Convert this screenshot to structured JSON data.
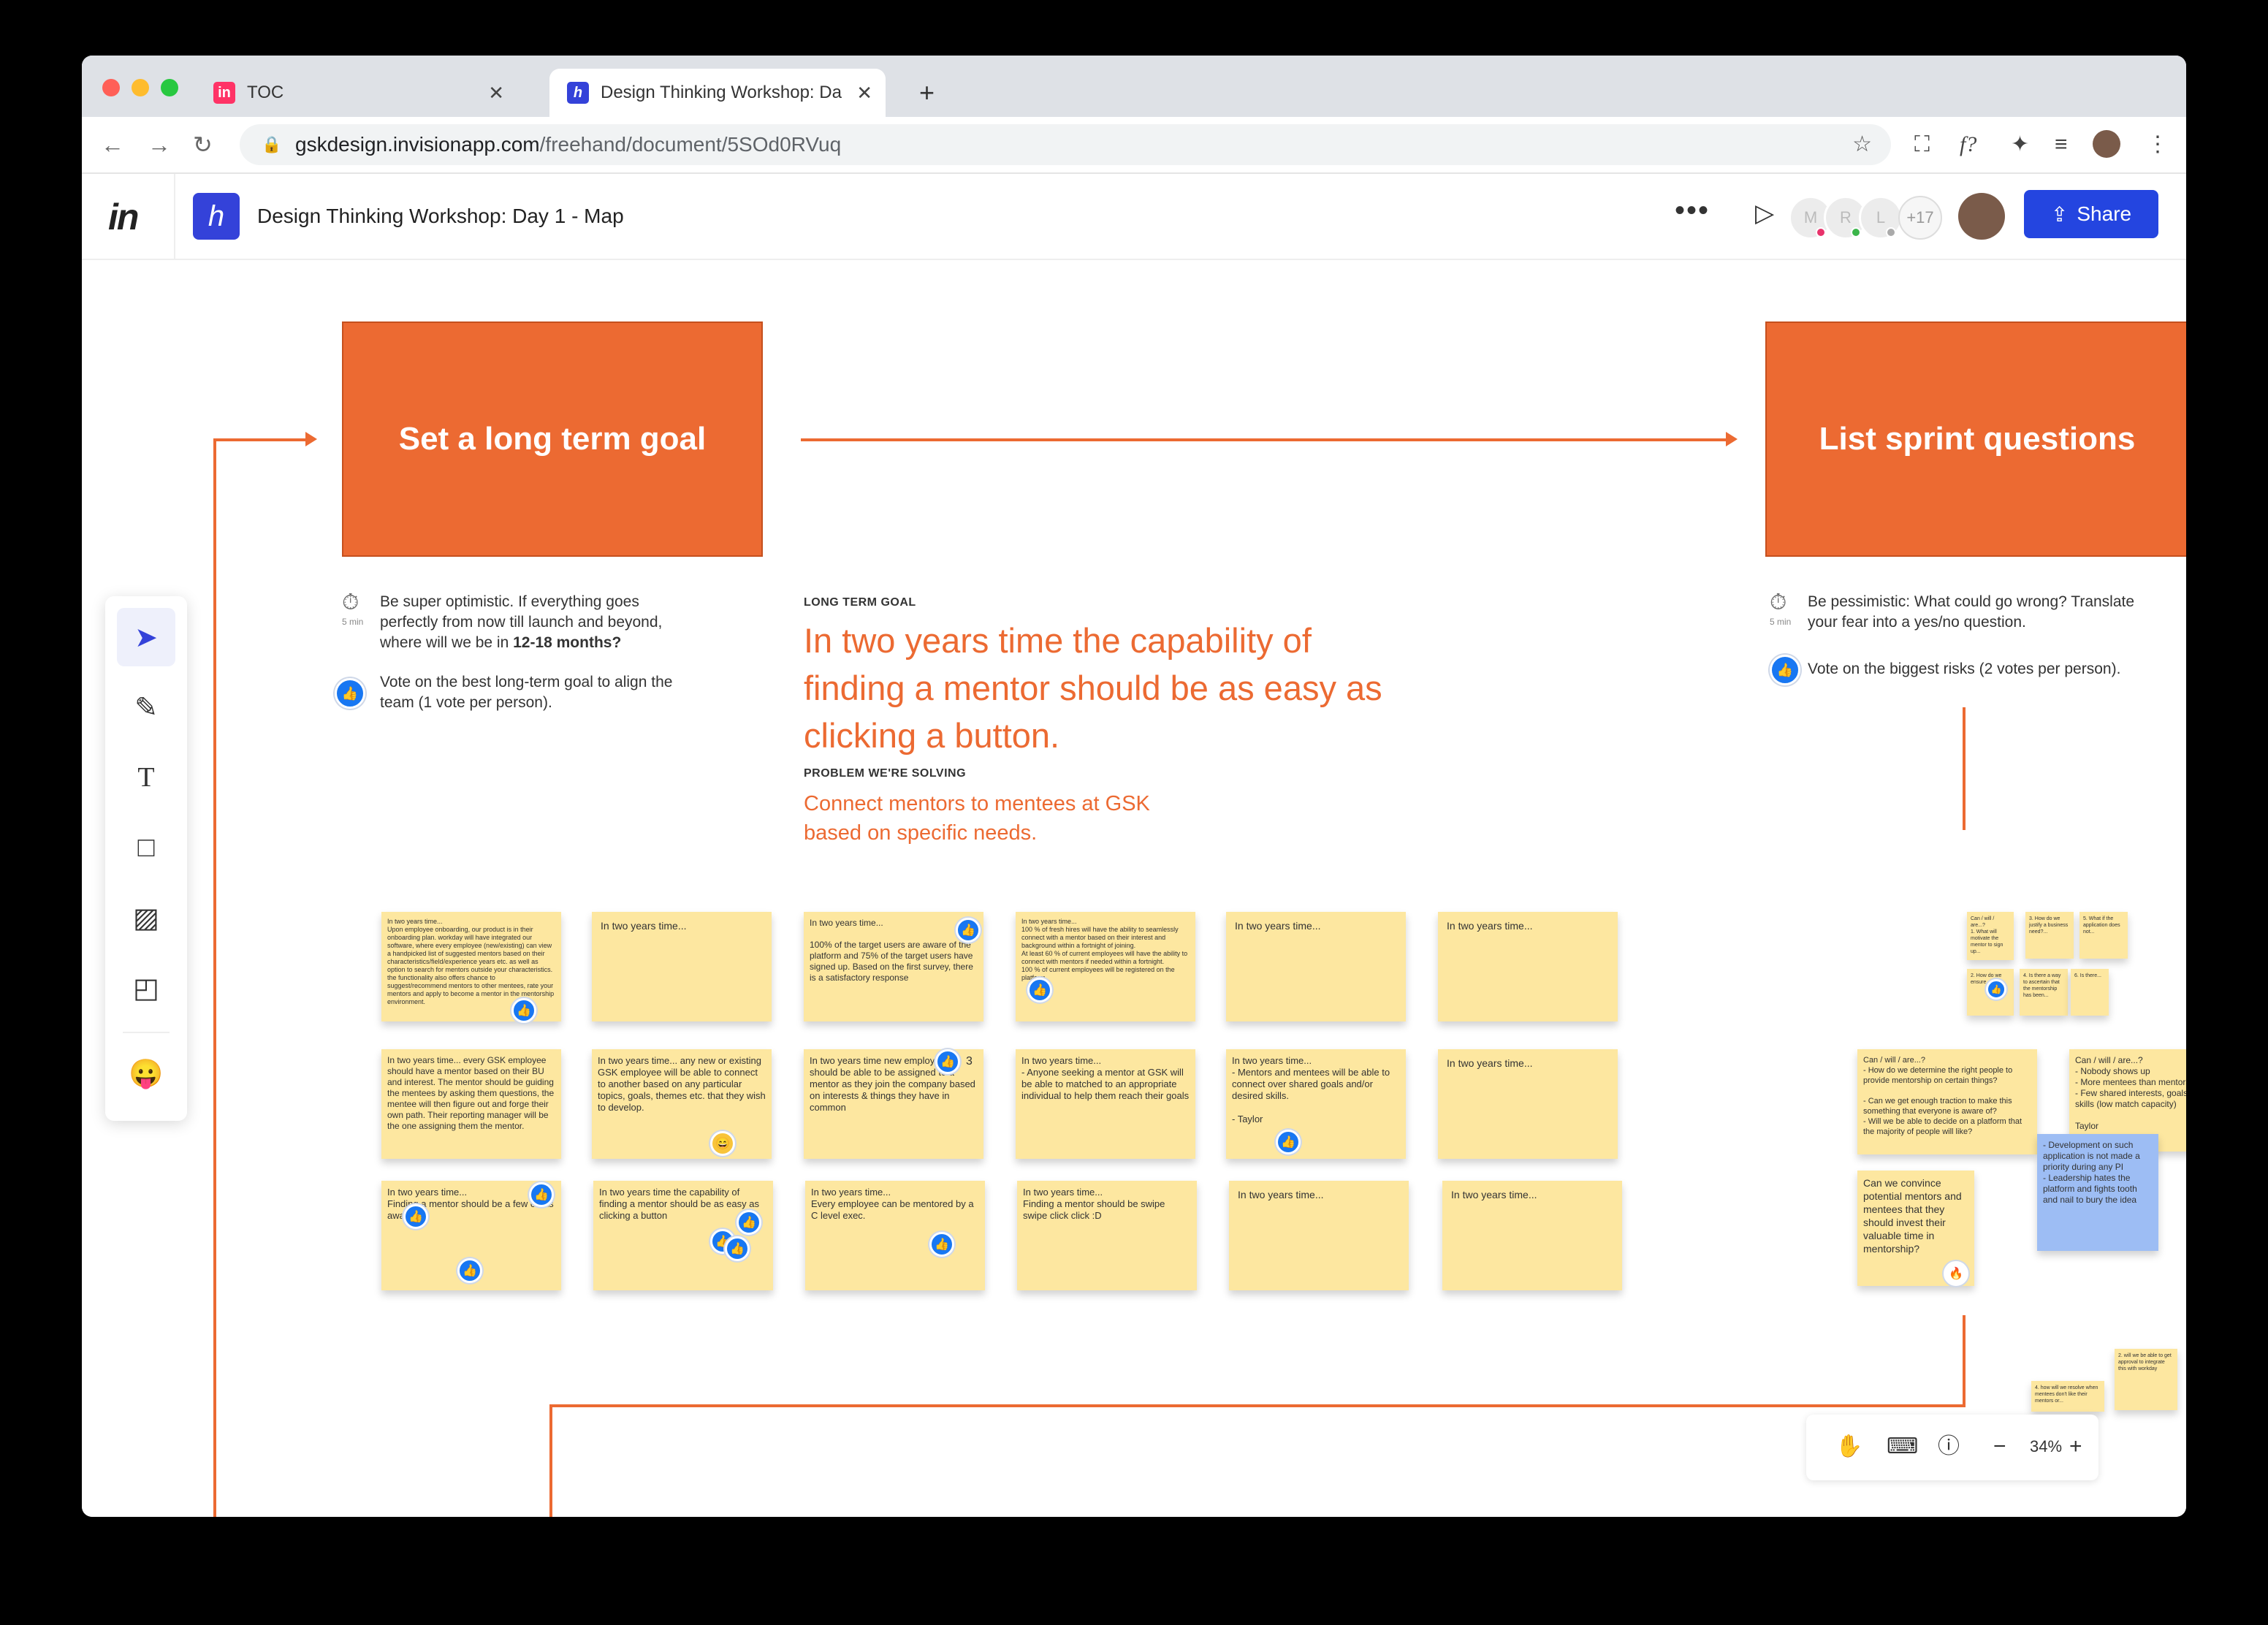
{
  "browser": {
    "tabs": [
      {
        "title": "TOC",
        "favicon": "in"
      },
      {
        "title": "Design Thinking Workshop: Da",
        "favicon": "h"
      }
    ],
    "url_host": "gskdesign.invisionapp.com",
    "url_path": "/freehand/document/5SOd0RVuq"
  },
  "app": {
    "logo": "in",
    "doc_title": "Design Thinking Workshop: Day 1 - Map",
    "more_label": "•••",
    "collaborators": [
      "M",
      "R",
      "L"
    ],
    "collaborator_overflow": "+17",
    "share_label": "Share"
  },
  "board": {
    "goal_box": "Set a long term goal",
    "sprint_box": "List sprint questions",
    "left_timer": "5 min",
    "left_instruction_1": "Be super optimistic. If everything goes perfectly from now till launch and beyond, where will we be in ",
    "left_instruction_bold": "12-18 months?",
    "left_instruction_2": "Vote on the best long-term goal to align the team (1 vote per person).",
    "right_timer": "5 min",
    "right_instruction_1": "Be pessimistic: What could go wrong? Translate your fear into a yes/no question.",
    "right_instruction_2": "Vote on the biggest risks (2 votes per person).",
    "goal_label": "LONG TERM GOAL",
    "goal_text": "In two years time the capability of finding a mentor should be as easy as clicking a button.",
    "problem_label": "PROBLEM WE'RE SOLVING",
    "problem_text": "Connect mentors to mentees at GSK based on specific needs."
  },
  "notes": [
    {
      "text": "In two years time...\nUpon employee onboarding, our product is in their onboarding plan. workday will have integrated our software, where every employee (new/existing) can view a handpicked list of suggested mentors based on their characteristics/field/experience years etc. as well as option to search for mentors outside your characteristics. the functionality also offers chance to suggest/recommend mentors to other mentees, rate your mentors and apply to become a mentor in the mentorship environment."
    },
    {
      "text": "In two years time..."
    },
    {
      "text": "In two years time...\n\n100% of the target users are aware of the platform and 75% of the target users have signed up. Based on the first survey, there is a satisfactory response"
    },
    {
      "text": "In two years time...\n100 % of fresh hires will have the ability to seamlessly connect with a mentor based on their interest and background within a fortnight of joining.\nAt least 60 % of current employees will have the ability to connect with mentors if needed within a fortnight.\n100 % of current employees will be registered on the platform"
    },
    {
      "text": "In two years time..."
    },
    {
      "text": "In two years time..."
    },
    {
      "text": "In two years time... every GSK employee should have a mentor based on their BU and interest. The mentor should be guiding the mentees by asking them questions, the mentee will then figure out and forge their own path. Their reporting manager will be the one assigning them the mentor."
    },
    {
      "text": "In two years time... any new or existing GSK employee will be able to connect to another based on any particular topics, goals, themes etc. that they wish to develop."
    },
    {
      "text": "In two years time new employees should be able to be assigned to a mentor as they join the company based on interests & things they have in common"
    },
    {
      "text": "In two years time...\n- Anyone seeking a mentor at GSK will be able to matched to an appropriate individual to help them reach their goals"
    },
    {
      "text": "In two years time...\n- Mentors and mentees will be able to connect over shared goals and/or desired skills.\n\n- Taylor"
    },
    {
      "text": "In two years time..."
    },
    {
      "text": "In two years time...\nFinding a mentor should be a few clicks away"
    },
    {
      "text": "In two years time the capability of finding a mentor should be as easy as clicking a button"
    },
    {
      "text": "In two years time...\nEvery employee can be mentored by a C level exec."
    },
    {
      "text": "In two years time...\nFinding a mentor should be swipe swipe click click :D"
    },
    {
      "text": "In two years time..."
    },
    {
      "text": "In two years time..."
    }
  ],
  "sprint_notes": [
    {
      "text": "Can / will / are...?\n- How do we determine the right people to provide mentorship on certain things?\n\n- Can we get enough traction to make this something that everyone is aware of?\n- Will we be able to decide on a platform that the majority of people will like?"
    },
    {
      "text": "Can / will / are...?\n- Nobody shows up\n- More mentees than mentors\n- Few shared interests, goals, desired skills (low match capacity)\n\nTaylor"
    },
    {
      "text": "Can we convince potential mentors and mentees that they should invest their valuable time in mentorship?"
    },
    {
      "text": "- Development on such application is not made a priority during any PI\n- Leadership hates the platform and fights tooth and nail to bury the idea"
    },
    {
      "text": "Can / will / are...?\n1. What will motivate the mentor to sign up..."
    },
    {
      "text": "3. How do we justify a business need?..."
    },
    {
      "text": "5. What if the application does not..."
    },
    {
      "text": "2. How do we ensure..."
    },
    {
      "text": "4. Is there a way to ascertain that the mentorship has been..."
    },
    {
      "text": "6. Is there..."
    },
    {
      "text": "2. will we be able to get approval to integrate this with workday"
    },
    {
      "text": "4. how will we resolve when mentees don't like their mentors or..."
    }
  ],
  "reactions": {
    "vote_count": "3"
  },
  "zoom": {
    "level": "34%"
  },
  "colors": {
    "accent": "#ec6a32",
    "brand": "#2445e0",
    "sticky": "#fde7a0",
    "sticky_blue": "#9dbdf4"
  }
}
